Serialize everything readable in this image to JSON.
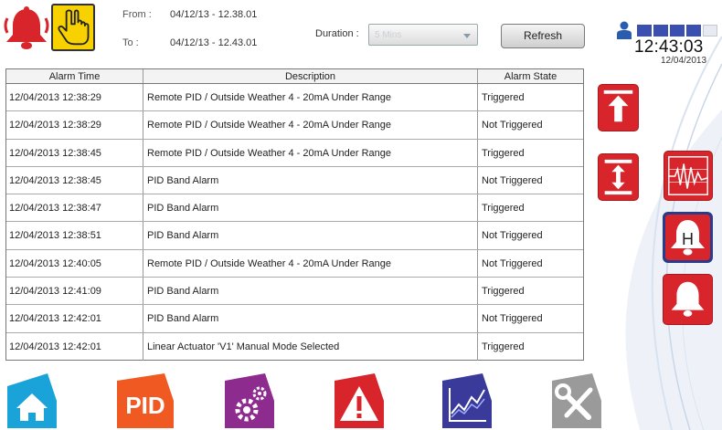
{
  "header": {
    "from_label": "From :",
    "from_value": "04/12/13 - 12.38.01",
    "to_label": "To :",
    "to_value": "04/12/13 - 12.43.01",
    "duration_label": "Duration :",
    "duration_value": "5 Mins",
    "refresh_label": "Refresh",
    "clock_time": "12:43:03",
    "clock_date": "12/04/2013"
  },
  "table": {
    "columns": [
      "Alarm Time",
      "Description",
      "Alarm State"
    ],
    "rows": [
      {
        "time": "12/04/2013 12:38:29",
        "desc": "Remote PID / Outside Weather 4 - 20mA Under Range",
        "state": "Triggered"
      },
      {
        "time": "12/04/2013 12:38:29",
        "desc": "Remote PID / Outside Weather 4 - 20mA Under Range",
        "state": "Not Triggered"
      },
      {
        "time": "12/04/2013 12:38:45",
        "desc": "Remote PID / Outside Weather 4 - 20mA Under Range",
        "state": "Triggered"
      },
      {
        "time": "12/04/2013 12:38:45",
        "desc": "PID Band Alarm",
        "state": "Not Triggered"
      },
      {
        "time": "12/04/2013 12:38:47",
        "desc": "PID Band Alarm",
        "state": "Triggered"
      },
      {
        "time": "12/04/2013 12:38:51",
        "desc": "PID Band Alarm",
        "state": "Not Triggered"
      },
      {
        "time": "12/04/2013 12:40:05",
        "desc": "Remote PID / Outside Weather 4 - 20mA Under Range",
        "state": "Not Triggered"
      },
      {
        "time": "12/04/2013 12:41:09",
        "desc": "PID Band Alarm",
        "state": "Triggered"
      },
      {
        "time": "12/04/2013 12:42:01",
        "desc": "PID Band Alarm",
        "state": "Not Triggered"
      },
      {
        "time": "12/04/2013 12:42:01",
        "desc": "Linear Actuator 'V1' Manual Mode Selected",
        "state": "Triggered"
      }
    ]
  },
  "side": {
    "high_alarm_letter": "H"
  },
  "nav": {
    "pid_label": "PID"
  },
  "icons": {
    "alarm": "bell-icon",
    "touch": "hand-pointer-icon",
    "user": "user-icon",
    "signal": "signal-strength-icon",
    "scroll_top": "scroll-to-top-icon",
    "scroll_range": "scroll-range-icon",
    "trend": "trend-waveform-icon",
    "high_alarm": "high-alarm-bell-icon",
    "alarm_bell": "alarm-bell-icon",
    "home": "home-icon",
    "pid": "pid-icon",
    "settings": "settings-gears-icon",
    "warning": "warning-icon",
    "chart": "chart-icon",
    "tools": "tools-icon"
  },
  "colors": {
    "alarm_red": "#d8252b",
    "touch_yellow": "#f7d100",
    "brand_blue": "#2a3b8a",
    "home_blue": "#1aa3d8",
    "pid_orange": "#f05a22",
    "settings_purple": "#8e2b8f",
    "chart_blue": "#3a3a9a",
    "tools_gray": "#9a9a9a"
  }
}
